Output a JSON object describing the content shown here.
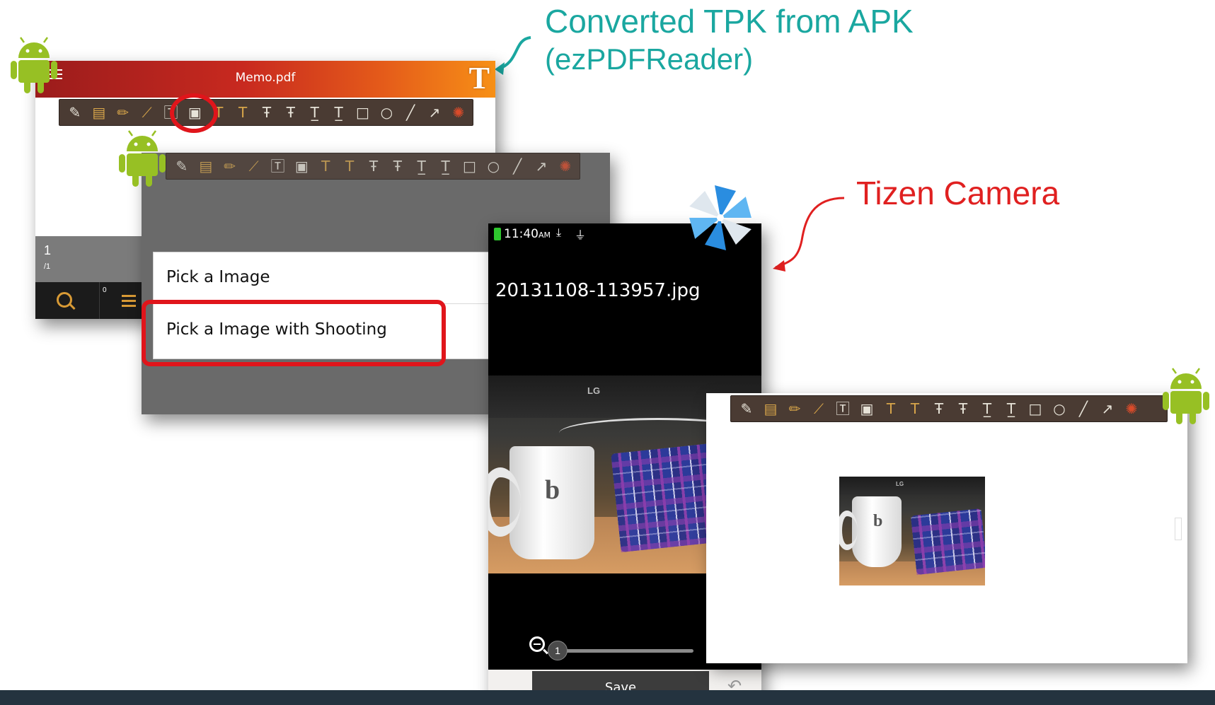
{
  "callouts": {
    "tpk_line1": "Converted TPK from APK",
    "tpk_line2": "(ezPDFReader)",
    "tizen": "Tizen Camera"
  },
  "ezpdf_window": {
    "title": "Memo.pdf",
    "title_logo": "T",
    "page_number": "1",
    "page_total": "/1",
    "badge_count": "0",
    "toolbar_icons": [
      "note-icon",
      "memo-icon",
      "pencil-icon",
      "brush-icon",
      "textbox-icon",
      "image-icon",
      "highlight-icon",
      "highlight-comment-icon",
      "strikeout-icon",
      "strikeout-comment-icon",
      "underline-icon",
      "underline-comment-icon",
      "rectangle-icon",
      "ellipse-icon",
      "line-icon",
      "arrow-icon",
      "eraser-icon"
    ]
  },
  "image_dialog": {
    "option_1": "Pick a Image",
    "option_2": "Pick a Image with Shooting"
  },
  "tizen_camera": {
    "time": "11:40",
    "ampm": "AM",
    "filename": "20131108-113957.jpg",
    "zoom_level": "1",
    "save_label": "Save",
    "photo_brand": "LG"
  },
  "result_window": {
    "thumb_brand": "LG"
  },
  "colors": {
    "callout_teal": "#1aa7a0",
    "callout_red": "#e02020",
    "highlight_red": "#e0151b",
    "android_green": "#97c024",
    "toolbar_brown": "#4a3b33"
  }
}
